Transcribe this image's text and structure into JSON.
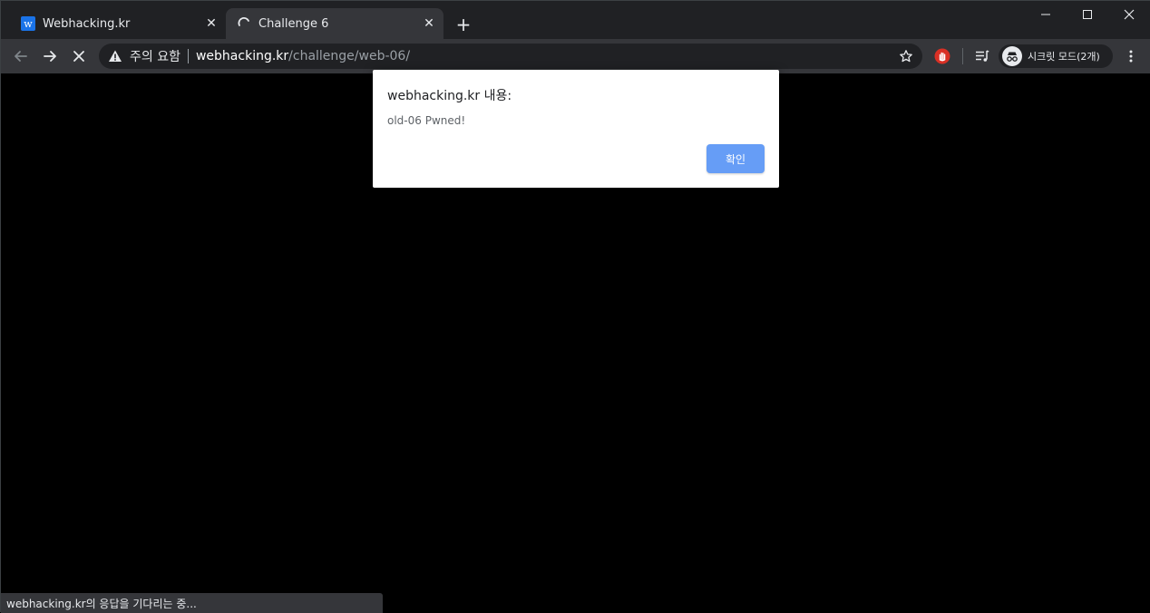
{
  "tabs": [
    {
      "title": "Webhacking.kr",
      "favicon_icon": "webhacking-w-icon",
      "active": false
    },
    {
      "title": "Challenge 6",
      "favicon_icon": "loading-spinner-icon",
      "active": true
    }
  ],
  "window_controls": [
    "minimize-icon",
    "maximize-icon",
    "close-icon"
  ],
  "toolbar": {
    "security_warning": "주의 요함",
    "url_host": "webhacking.kr",
    "url_path": "/challenge/web-06/",
    "incognito_label": "시크릿 모드(2개)"
  },
  "dialog": {
    "title": "webhacking.kr 내용:",
    "message": "old-06 Pwned!",
    "ok_label": "확인"
  },
  "status_bar": {
    "text": "webhacking.kr의 응답을 기다리는 중..."
  },
  "colors": {
    "tab_strip_bg": "#202124",
    "toolbar_bg": "#35363a",
    "page_bg": "#000000",
    "dialog_button": "#669df6",
    "extension_red": "#d93025"
  }
}
